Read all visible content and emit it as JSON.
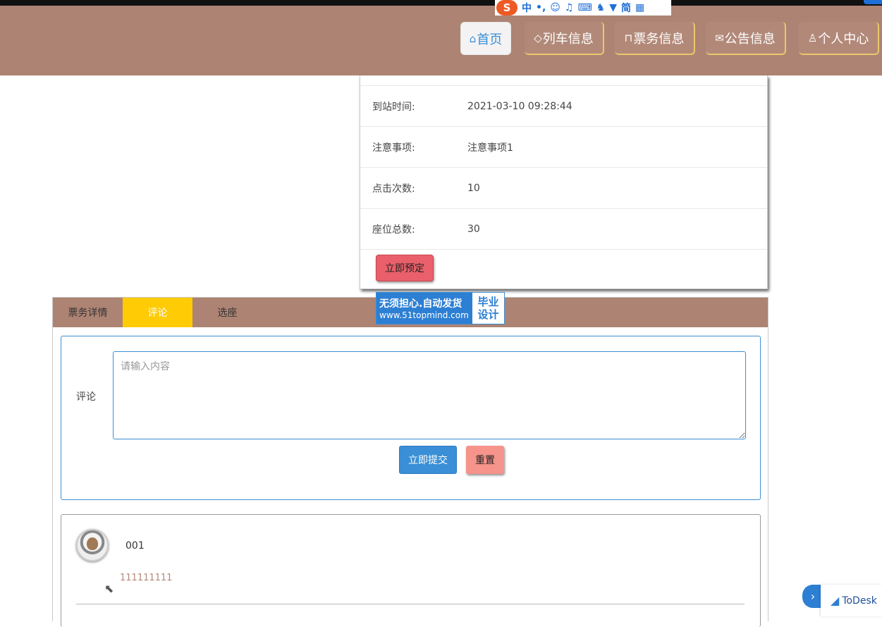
{
  "nav": {
    "items": [
      {
        "label": "首页",
        "icon": "home-icon",
        "glyph": "⌂"
      },
      {
        "label": "列车信息",
        "icon": "tag-icon",
        "glyph": "◇"
      },
      {
        "label": "票务信息",
        "icon": "book-icon",
        "glyph": "⊓"
      },
      {
        "label": "公告信息",
        "icon": "mail-icon",
        "glyph": "✉"
      },
      {
        "label": "个人中心",
        "icon": "user-icon",
        "glyph": "♙"
      }
    ]
  },
  "ime": {
    "logo": "S",
    "items": [
      "中",
      "•,",
      "☺",
      "♫",
      "⌨",
      "♞",
      "▼",
      "简",
      "▦"
    ]
  },
  "detail": {
    "rows": [
      {
        "label": "到站时间:",
        "value": "2021-03-10 09:28:44"
      },
      {
        "label": "注意事项:",
        "value": "注意事项1"
      },
      {
        "label": "点击次数:",
        "value": "10"
      },
      {
        "label": "座位总数:",
        "value": "30"
      }
    ],
    "book_label": "立即预定"
  },
  "banner": {
    "line1": "无须担心.自动发货",
    "line2": "www.51topmind.com",
    "side1": "毕业",
    "side2": "设计"
  },
  "tabs": {
    "items": [
      "票务详情",
      "评论",
      "选座"
    ]
  },
  "comment_form": {
    "label": "评论",
    "placeholder": "请输入内容",
    "submit_label": "立即提交",
    "reset_label": "重置"
  },
  "comments": [
    {
      "user": "001",
      "content": "111111111"
    }
  ],
  "todesk": {
    "label": "ToDesk",
    "arrow": "›"
  },
  "colors": {
    "header": "#ad8373",
    "active_tab": "#ffcb05",
    "accent": "#3a8fd6",
    "danger": "#e9606a"
  }
}
